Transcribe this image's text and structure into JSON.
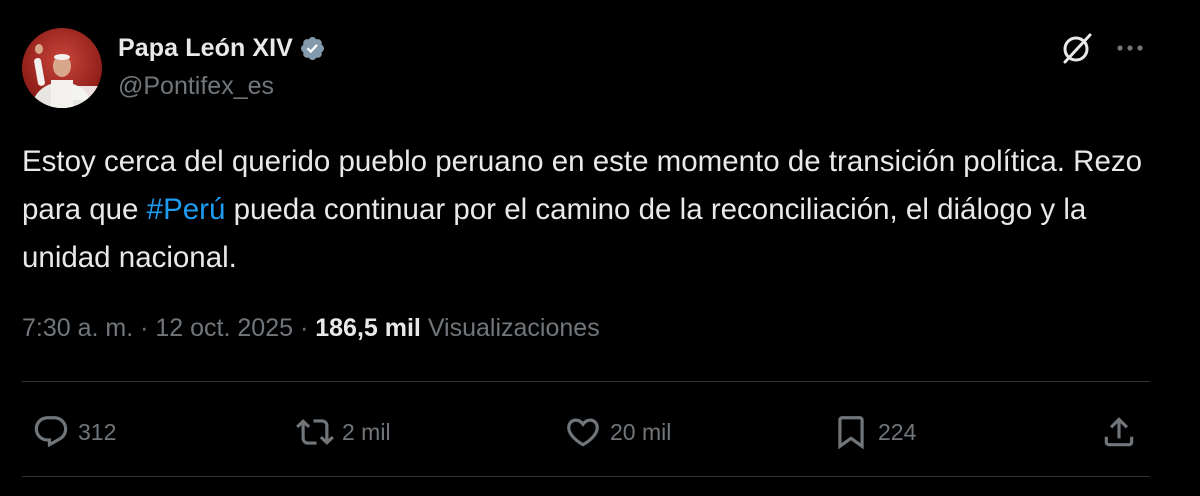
{
  "author": {
    "display_name": "Papa León XIV",
    "handle": "@Pontifex_es",
    "verified": true,
    "verified_color": "#829aab"
  },
  "tweet": {
    "text_before_hashtag": "Estoy cerca del querido pueblo peruano en este momento de transición política. Rezo para que ",
    "hashtag": "#Perú",
    "text_after_hashtag": " pueda continuar por el camino de la reconciliación, el diálogo y la unidad nacional.",
    "hashtag_color": "#1d9bf0"
  },
  "meta": {
    "time": "7:30 a. m.",
    "separator": " · ",
    "date": "12 oct. 2025",
    "views_count": "186,5 mil",
    "views_label": "Visualizaciones"
  },
  "actions": {
    "reply_count": "312",
    "repost_count": "2 mil",
    "like_count": "20 mil",
    "bookmark_count": "224"
  },
  "icons": {
    "avatar": "avatar-image",
    "verified": "verified-badge-icon",
    "grok": "grok-icon",
    "more": "more-icon",
    "reply": "reply-icon",
    "repost": "repost-icon",
    "like": "heart-icon",
    "bookmark": "bookmark-icon",
    "share": "share-icon"
  },
  "colors": {
    "background": "#000000",
    "text": "#e7e9ea",
    "secondary_text": "#71767b",
    "divider": "#2f3336"
  }
}
